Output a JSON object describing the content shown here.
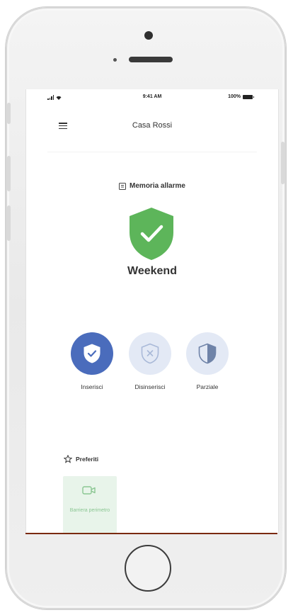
{
  "status_bar": {
    "time": "9:41 AM",
    "battery": "100%"
  },
  "app_bar": {
    "title": "Casa Rossi",
    "menu_icon": "hamburger-menu-icon"
  },
  "alarm_memory": {
    "label": "Memoria allarme",
    "icon": "document-icon"
  },
  "system_status": {
    "mode": "Weekend",
    "icon": "shield-check-icon",
    "color": "#5db55a"
  },
  "actions": [
    {
      "label": "Inserisci",
      "icon": "shield-check-icon",
      "active": true,
      "color": "#4a6cbc"
    },
    {
      "label": "Disinserisci",
      "icon": "shield-x-icon",
      "active": false,
      "color": "#e3e9f5"
    },
    {
      "label": "Parziale",
      "icon": "half-shield-icon",
      "active": false,
      "color": "#e3e9f5"
    }
  ],
  "favorites": {
    "title": "Preferiti",
    "icon": "star-outline-icon",
    "items": [
      {
        "label": "Barriera perimetro",
        "icon": "camera-icon",
        "color": "#8ac692"
      }
    ]
  }
}
